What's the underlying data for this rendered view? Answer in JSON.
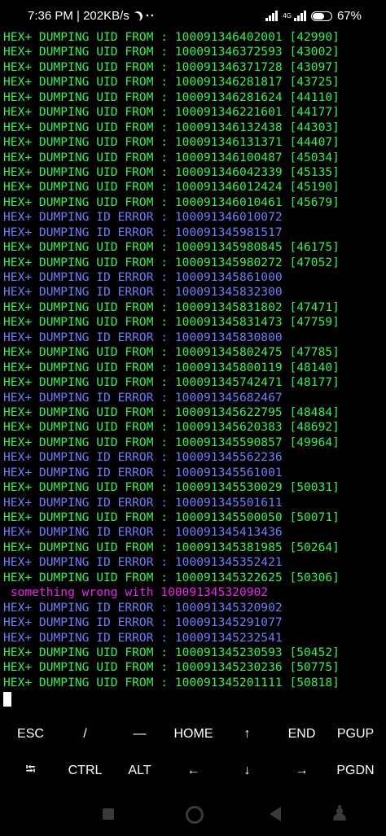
{
  "status_bar": {
    "time_speed": "7:36 PM | 202KB/s",
    "dots": "··",
    "network_tag": "4G",
    "battery_text": "67%",
    "battery_level": 0.67
  },
  "terminal": {
    "lines": [
      {
        "text": "HEX+ DUMPING UID FROM : 100091346402001 [42990]",
        "kind": "ok"
      },
      {
        "text": "HEX+ DUMPING UID FROM : 100091346372593 [43002]",
        "kind": "ok"
      },
      {
        "text": "HEX+ DUMPING UID FROM : 100091346371728 [43097]",
        "kind": "ok"
      },
      {
        "text": "HEX+ DUMPING UID FROM : 100091346281817 [43725]",
        "kind": "ok"
      },
      {
        "text": "HEX+ DUMPING UID FROM : 100091346281624 [44110]",
        "kind": "ok"
      },
      {
        "text": "HEX+ DUMPING UID FROM : 100091346221601 [44177]",
        "kind": "ok"
      },
      {
        "text": "HEX+ DUMPING UID FROM : 100091346132438 [44303]",
        "kind": "ok"
      },
      {
        "text": "HEX+ DUMPING UID FROM : 100091346131371 [44407]",
        "kind": "ok"
      },
      {
        "text": "HEX+ DUMPING UID FROM : 100091346100487 [45034]",
        "kind": "ok"
      },
      {
        "text": "HEX+ DUMPING UID FROM : 100091346042339 [45135]",
        "kind": "ok"
      },
      {
        "text": "HEX+ DUMPING UID FROM : 100091346012424 [45190]",
        "kind": "ok"
      },
      {
        "text": "HEX+ DUMPING UID FROM : 100091346010461 [45679]",
        "kind": "ok"
      },
      {
        "text": "HEX+ DUMPING ID ERROR : 100091346010072",
        "kind": "err"
      },
      {
        "text": "HEX+ DUMPING ID ERROR : 100091345981517",
        "kind": "err"
      },
      {
        "text": "HEX+ DUMPING UID FROM : 100091345980845 [46175]",
        "kind": "ok"
      },
      {
        "text": "HEX+ DUMPING UID FROM : 100091345980272 [47052]",
        "kind": "ok"
      },
      {
        "text": "HEX+ DUMPING ID ERROR : 100091345861000",
        "kind": "err"
      },
      {
        "text": "HEX+ DUMPING ID ERROR : 100091345832300",
        "kind": "err"
      },
      {
        "text": "HEX+ DUMPING UID FROM : 100091345831802 [47471]",
        "kind": "ok"
      },
      {
        "text": "HEX+ DUMPING UID FROM : 100091345831473 [47759]",
        "kind": "ok"
      },
      {
        "text": "HEX+ DUMPING ID ERROR : 100091345830800",
        "kind": "err"
      },
      {
        "text": "HEX+ DUMPING UID FROM : 100091345802475 [47785]",
        "kind": "ok"
      },
      {
        "text": "HEX+ DUMPING UID FROM : 100091345800119 [48140]",
        "kind": "ok"
      },
      {
        "text": "HEX+ DUMPING UID FROM : 100091345742471 [48177]",
        "kind": "ok"
      },
      {
        "text": "HEX+ DUMPING ID ERROR : 100091345682467",
        "kind": "err"
      },
      {
        "text": "HEX+ DUMPING UID FROM : 100091345622795 [48484]",
        "kind": "ok"
      },
      {
        "text": "HEX+ DUMPING UID FROM : 100091345620383 [48692]",
        "kind": "ok"
      },
      {
        "text": "HEX+ DUMPING UID FROM : 100091345590857 [49964]",
        "kind": "ok"
      },
      {
        "text": "HEX+ DUMPING ID ERROR : 100091345562236",
        "kind": "err"
      },
      {
        "text": "HEX+ DUMPING ID ERROR : 100091345561001",
        "kind": "err"
      },
      {
        "text": "HEX+ DUMPING UID FROM : 100091345530029 [50031]",
        "kind": "ok"
      },
      {
        "text": "HEX+ DUMPING ID ERROR : 100091345501611",
        "kind": "err"
      },
      {
        "text": "HEX+ DUMPING UID FROM : 100091345500050 [50071]",
        "kind": "ok"
      },
      {
        "text": "HEX+ DUMPING ID ERROR : 100091345413436",
        "kind": "err"
      },
      {
        "text": "HEX+ DUMPING UID FROM : 100091345381985 [50264]",
        "kind": "ok"
      },
      {
        "text": "HEX+ DUMPING ID ERROR : 100091345352421",
        "kind": "err"
      },
      {
        "text": "HEX+ DUMPING UID FROM : 100091345322625 [50306]",
        "kind": "ok"
      },
      {
        "text": " something wrong with 100091345320902",
        "kind": "warn"
      },
      {
        "text": "HEX+ DUMPING ID ERROR : 100091345320902",
        "kind": "err"
      },
      {
        "text": "HEX+ DUMPING ID ERROR : 100091345291077",
        "kind": "err"
      },
      {
        "text": "HEX+ DUMPING ID ERROR : 100091345232541",
        "kind": "err"
      },
      {
        "text": "HEX+ DUMPING UID FROM : 100091345230593 [50452]",
        "kind": "ok"
      },
      {
        "text": "HEX+ DUMPING UID FROM : 100091345230236 [50775]",
        "kind": "ok"
      },
      {
        "text": "HEX+ DUMPING UID FROM : 100091345201111 [50818]",
        "kind": "ok"
      }
    ]
  },
  "extra_keys": {
    "row1": [
      "ESC",
      "/",
      "—",
      "HOME",
      "↑",
      "END",
      "PGUP"
    ],
    "row2": [
      "⭾",
      "CTRL",
      "ALT",
      "←",
      "↓",
      "→",
      "PGDN"
    ]
  },
  "colors": {
    "ok": "#2ef34d",
    "error": "#6f7cff",
    "warning": "#ee22ee",
    "background": "#000000"
  },
  "icons": {
    "status": [
      "moon-icon",
      "signal-icon",
      "battery-icon"
    ],
    "nav": [
      "recents-icon",
      "home-icon",
      "back-icon",
      "accessibility-icon"
    ]
  }
}
